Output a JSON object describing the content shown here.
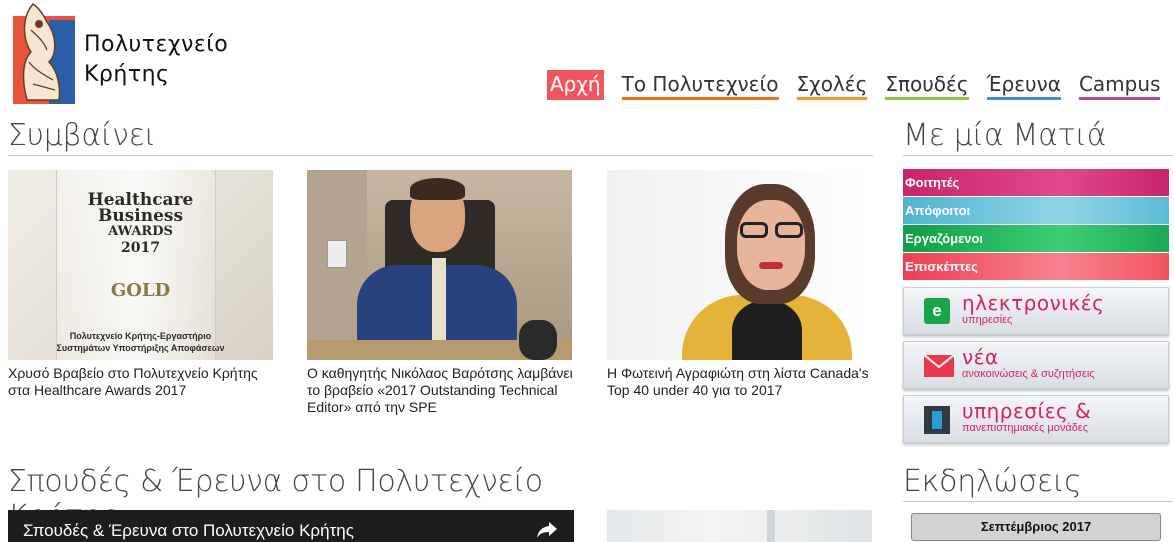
{
  "header": {
    "logo_line1": "Πολυτεχνείο",
    "logo_line2": "Κρήτης"
  },
  "nav": [
    {
      "label": "Αρχή",
      "color": "#f0545e"
    },
    {
      "label": "Το Πολυτεχνείο",
      "color": "#e8721c"
    },
    {
      "label": "Σχολές",
      "color": "#f29a1f"
    },
    {
      "label": "Σπουδές",
      "color": "#8cc63f"
    },
    {
      "label": "Έρευνα",
      "color": "#3a8fc7"
    },
    {
      "label": "Campus",
      "color": "#b04a8a"
    }
  ],
  "news": {
    "title": "Συμβαίνει",
    "items": [
      {
        "caption": "Χρυσό Βραβείο στο Πολυτεχνείο Κρήτης στα Healthcare Awards 2017",
        "award_lines": [
          "Healthcare",
          "Business",
          "AWARDS",
          "2017"
        ],
        "award_gold": "GOLD",
        "award_sub1": "Πολυτεχνείο Κρήτης-Εργαστήριο",
        "award_sub2": "Συστημάτων Υποστήριξης Αποφάσεων"
      },
      {
        "caption": "Ο καθηγητής Νικόλαος Βαρότσης λαμβάνει το βραβείο «2017 Outstanding Technical Editor» από την SPE"
      },
      {
        "caption": "Η Φωτεινή Αγραφιώτη στη λίστα Canada's Top 40 under 40 για το 2017"
      }
    ]
  },
  "glance": {
    "title": "Με μία Ματιά",
    "items": [
      {
        "label": "Φοιτητές",
        "color": "#c8246c"
      },
      {
        "label": "Απόφοιτοι",
        "color": "#5bbcd6"
      },
      {
        "label": "Εργαζόμενοι",
        "color": "#1aaa55"
      },
      {
        "label": "Επισκέπτες",
        "color": "#f0545e"
      }
    ]
  },
  "services": [
    {
      "big": "ηλεκτρονικές",
      "small": "υπηρεσίες",
      "icon": "e-services-icon",
      "icon_text": "e"
    },
    {
      "big": "νέα",
      "small": "ανακοινώσεις & συζητήσεις",
      "icon": "mail-icon"
    },
    {
      "big": "υπηρεσίες &",
      "small": "πανεπιστημιακές μονάδες",
      "icon": "building-icon"
    }
  ],
  "studies": {
    "title": "Σπουδές & Έρευνα στο Πολυτεχνείο Κρήτης",
    "video_title": "Σπουδές & Έρευνα στο Πολυτεχνείο Κρήτης"
  },
  "events": {
    "title": "Εκδηλώσεις",
    "month": "Σεπτέμβριος 2017"
  }
}
